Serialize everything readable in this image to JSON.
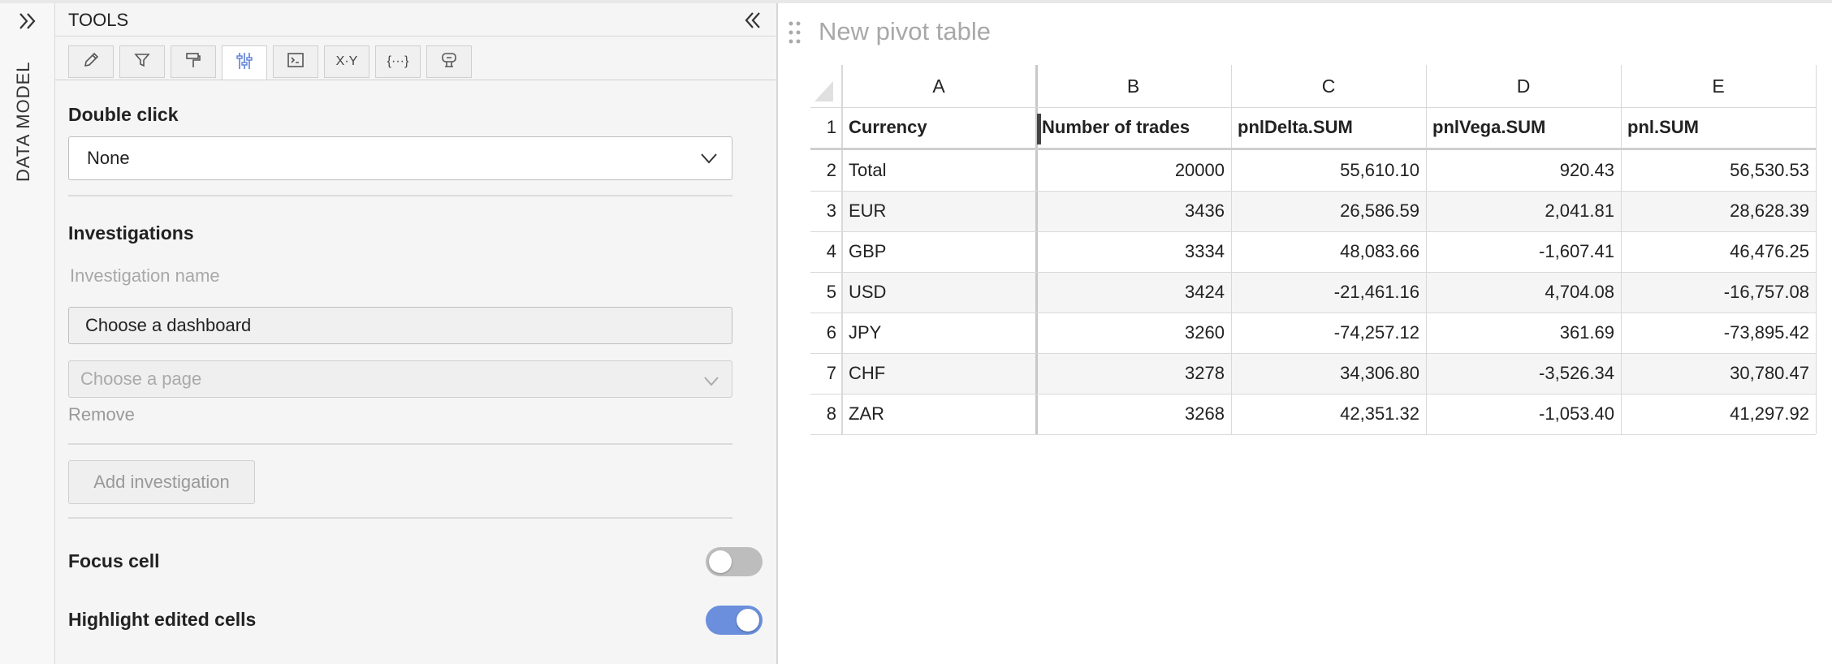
{
  "rail": {
    "label": "DATA MODEL",
    "expand_icon": "double-chevron-right-icon"
  },
  "tools": {
    "title": "TOOLS",
    "collapse_icon": "double-chevron-left-icon",
    "tabs": [
      {
        "icon": "pencil-icon",
        "text": ""
      },
      {
        "icon": "filter-icon",
        "text": ""
      },
      {
        "icon": "paint-roller-icon",
        "text": ""
      },
      {
        "icon": "sliders-icon",
        "text": "",
        "active": true
      },
      {
        "icon": "terminal-icon",
        "text": ""
      },
      {
        "icon": "xy-icon",
        "text": "X·Y"
      },
      {
        "icon": "braces-icon",
        "text": "{···}"
      },
      {
        "icon": "widget-icon",
        "text": ""
      }
    ],
    "double_click": {
      "label": "Double click",
      "value": "None"
    },
    "investigations": {
      "label": "Investigations",
      "name_placeholder": "Investigation name",
      "dashboard_value": "Choose a dashboard",
      "page_placeholder": "Choose a page",
      "remove_label": "Remove",
      "add_label": "Add investigation"
    },
    "focus_cell": {
      "label": "Focus cell",
      "on": false
    },
    "highlight_edited": {
      "label": "Highlight edited cells",
      "on": true
    }
  },
  "pivot": {
    "title": "New pivot table",
    "columns": [
      "A",
      "B",
      "C",
      "D",
      "E"
    ],
    "row_numbers": [
      "1",
      "2",
      "3",
      "4",
      "5",
      "6",
      "7",
      "8"
    ],
    "headers": [
      "Currency",
      "Number of trades",
      "pnlDelta.SUM",
      "pnlVega.SUM",
      "pnl.SUM"
    ],
    "rows": [
      [
        "Total",
        "20000",
        "55,610.10",
        "920.43",
        "56,530.53"
      ],
      [
        "EUR",
        "3436",
        "26,586.59",
        "2,041.81",
        "28,628.39"
      ],
      [
        "GBP",
        "3334",
        "48,083.66",
        "-1,607.41",
        "46,476.25"
      ],
      [
        "USD",
        "3424",
        "-21,461.16",
        "4,704.08",
        "-16,757.08"
      ],
      [
        "JPY",
        "3260",
        "-74,257.12",
        "361.69",
        "-73,895.42"
      ],
      [
        "CHF",
        "3278",
        "34,306.80",
        "-3,526.34",
        "30,780.47"
      ],
      [
        "ZAR",
        "3268",
        "42,351.32",
        "-1,053.40",
        "41,297.92"
      ]
    ]
  },
  "colors": {
    "accent": "#6b8fdc",
    "toggle_off": "#bdbdbd"
  }
}
